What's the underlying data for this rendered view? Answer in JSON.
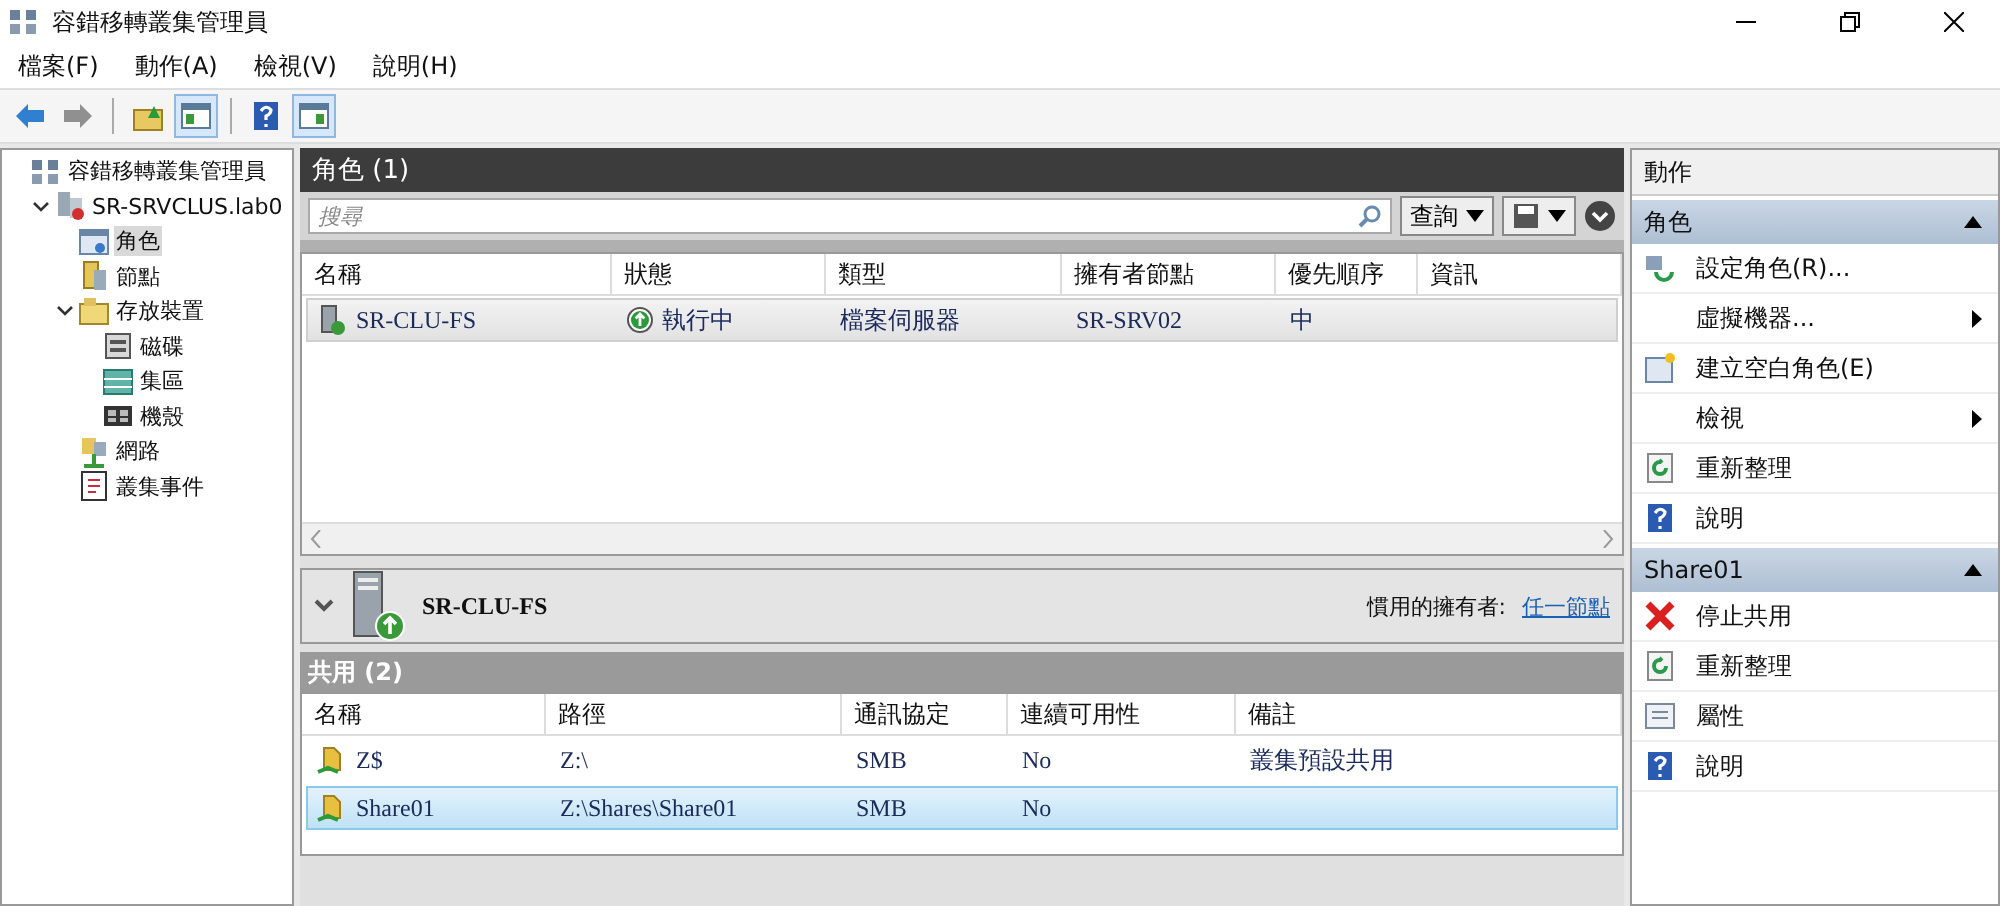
{
  "window": {
    "title": "容錯移轉叢集管理員"
  },
  "menu": [
    {
      "label": "檔案(F)"
    },
    {
      "label": "動作(A)"
    },
    {
      "label": "檢視(V)"
    },
    {
      "label": "說明(H)"
    }
  ],
  "toolbar": [
    {
      "kind": "back",
      "pressed": false
    },
    {
      "kind": "forward",
      "pressed": false
    },
    {
      "kind": "up",
      "pressed": false
    },
    {
      "kind": "tree",
      "pressed": true
    },
    {
      "kind": "help",
      "pressed": false
    },
    {
      "kind": "pane",
      "pressed": true
    }
  ],
  "tree": {
    "label": "容錯移轉叢集管理員",
    "kind": "root",
    "children": [
      {
        "label": "SR-SRVCLUS.lab0",
        "kind": "cluster",
        "expanded": true,
        "selected": false,
        "children": [
          {
            "label": "角色",
            "kind": "roles",
            "selected": true
          },
          {
            "label": "節點",
            "kind": "nodes",
            "selected": false
          },
          {
            "label": "存放裝置",
            "kind": "storage",
            "expanded": true,
            "selected": false,
            "children": [
              {
                "label": "磁碟",
                "kind": "disk",
                "selected": false
              },
              {
                "label": "集區",
                "kind": "pool",
                "selected": false
              },
              {
                "label": "機殼",
                "kind": "enclosure",
                "selected": false
              }
            ]
          },
          {
            "label": "網路",
            "kind": "network",
            "selected": false
          },
          {
            "label": "叢集事件",
            "kind": "events",
            "selected": false
          }
        ]
      }
    ]
  },
  "roles": {
    "title": "角色 (1)",
    "search": {
      "placeholder": "搜尋"
    },
    "query_button": "查詢",
    "columns": [
      "名稱",
      "狀態",
      "類型",
      "擁有者節點",
      "優先順序",
      "資訊"
    ],
    "rows": [
      {
        "name": "SR-CLU-FS",
        "status": "執行中",
        "type": "檔案伺服器",
        "owner": "SR-SRV02",
        "priority": "中",
        "selected": true
      }
    ]
  },
  "details": {
    "name": "SR-CLU-FS",
    "owner_label": "慣用的擁有者:",
    "owner_link": "任一節點",
    "shares_title": "共用 (2)",
    "columns": [
      "名稱",
      "路徑",
      "通訊協定",
      "連續可用性",
      "備註"
    ],
    "rows": [
      {
        "name": "Z$",
        "path": "Z:\\",
        "protocol": "SMB",
        "continuous": "No",
        "remark": "叢集預設共用",
        "selected": false
      },
      {
        "name": "Share01",
        "path": "Z:\\Shares\\Share01",
        "protocol": "SMB",
        "continuous": "No",
        "selected": true
      }
    ]
  },
  "actions": {
    "title": "動作",
    "sections": [
      {
        "title": "角色",
        "expanded": true,
        "items": [
          {
            "label": "設定角色(R)...",
            "kind": "configure",
            "submenu": false
          },
          {
            "label": "虛擬機器...",
            "kind": "none",
            "submenu": true
          },
          {
            "label": "建立空白角色(E)",
            "kind": "create",
            "submenu": false
          },
          {
            "label": "檢視",
            "kind": "none",
            "submenu": true
          },
          {
            "label": "重新整理",
            "kind": "refresh",
            "submenu": false
          },
          {
            "label": "說明",
            "kind": "help",
            "submenu": false
          }
        ]
      },
      {
        "title": "Share01",
        "expanded": true,
        "items": [
          {
            "label": "停止共用",
            "kind": "stop",
            "submenu": false
          },
          {
            "label": "重新整理",
            "kind": "refresh",
            "submenu": false
          },
          {
            "label": "屬性",
            "kind": "properties",
            "submenu": false
          },
          {
            "label": "說明",
            "kind": "help",
            "submenu": false
          }
        ]
      }
    ]
  }
}
